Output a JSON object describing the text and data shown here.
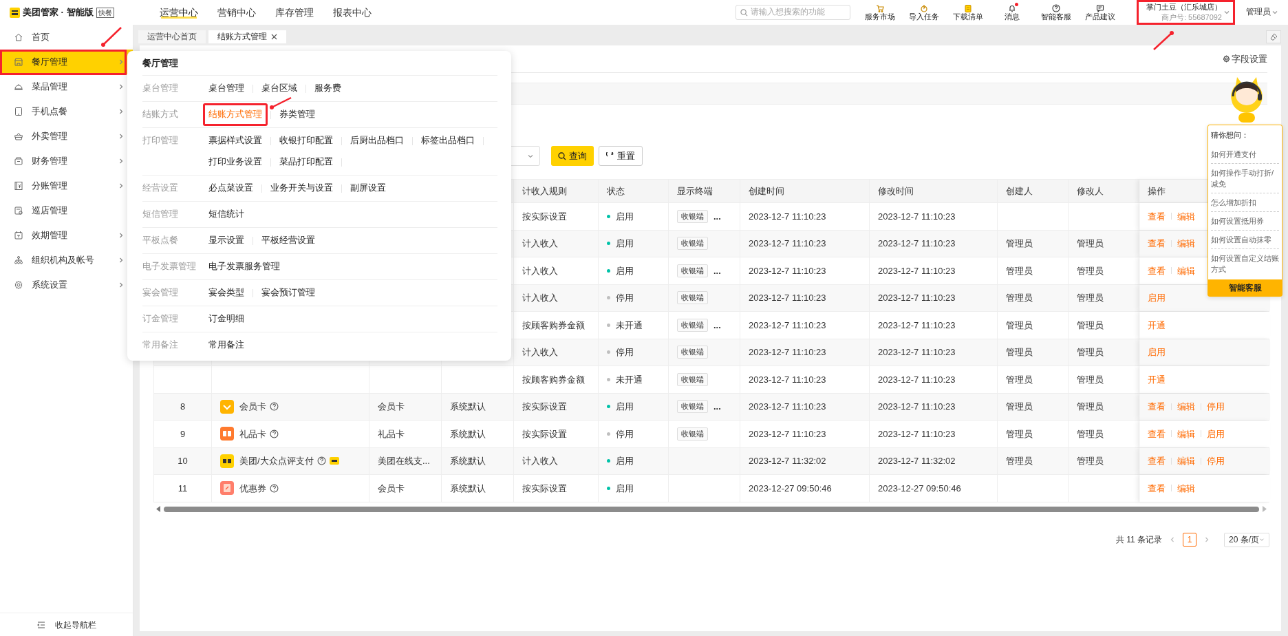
{
  "header": {
    "brand": "美团管家 · 智能版",
    "edition_badge": "快餐"
  },
  "top_nav": [
    {
      "label": "运营中心",
      "selected": true
    },
    {
      "label": "营销中心",
      "selected": false
    },
    {
      "label": "库存管理",
      "selected": false
    },
    {
      "label": "报表中心",
      "selected": false
    }
  ],
  "search": {
    "placeholder": "请输入想搜索的功能"
  },
  "toolbar": [
    {
      "label": "服务市场",
      "unread": false
    },
    {
      "label": "导入任务",
      "unread": false
    },
    {
      "label": "下载清单",
      "unread": false
    },
    {
      "label": "消息",
      "unread": true
    },
    {
      "label": "智能客服",
      "unread": false
    },
    {
      "label": "产品建议",
      "unread": false
    }
  ],
  "store": {
    "name": "掌门土豆（汇乐城店）",
    "merchant_id": "商户号: 55687092"
  },
  "user": "管理员",
  "sidebar": {
    "items": [
      {
        "label": "首页",
        "selected": false,
        "has_children": false
      },
      {
        "label": "餐厅管理",
        "selected": true,
        "has_children": true
      },
      {
        "label": "菜品管理",
        "selected": false,
        "has_children": true
      },
      {
        "label": "手机点餐",
        "selected": false,
        "has_children": true
      },
      {
        "label": "外卖管理",
        "selected": false,
        "has_children": true
      },
      {
        "label": "财务管理",
        "selected": false,
        "has_children": true
      },
      {
        "label": "分账管理",
        "selected": false,
        "has_children": true
      },
      {
        "label": "巡店管理",
        "selected": false,
        "has_children": false
      },
      {
        "label": "效期管理",
        "selected": false,
        "has_children": true
      },
      {
        "label": "组织机构及帐号",
        "selected": false,
        "has_children": true
      },
      {
        "label": "系统设置",
        "selected": false,
        "has_children": true
      }
    ],
    "collapse_label": "收起导航栏"
  },
  "tabs": [
    {
      "label": "运营中心首页",
      "selected": false,
      "closable": false
    },
    {
      "label": "结账方式管理",
      "selected": true,
      "closable": true
    }
  ],
  "field_settings": "字段设置",
  "filters": {
    "query_button": "查询",
    "reset_button": "重置"
  },
  "table": {
    "columns": [
      "计收入规则",
      "状态",
      "显示终端",
      "创建时间",
      "修改时间",
      "创建人",
      "修改人",
      "操作"
    ],
    "rows": [
      {
        "rule": "按实际设置",
        "status": "启用",
        "enabled": true,
        "terminal": "收银端",
        "more": "...",
        "created": "2023-12-7 11:10:23",
        "modified": "2023-12-7 11:10:23",
        "actions": [
          "查看",
          "编辑"
        ]
      },
      {
        "rule": "计入收入",
        "status": "启用",
        "enabled": true,
        "terminal": "收银端",
        "created": "2023-12-7 11:10:23",
        "modified": "2023-12-7 11:10:23",
        "creator": "管理员",
        "modifier": "管理员",
        "actions": [
          "查看",
          "编辑"
        ]
      },
      {
        "rule": "计入收入",
        "status": "启用",
        "enabled": true,
        "terminal": "收银端",
        "more": "...",
        "created": "2023-12-7 11:10:23",
        "modified": "2023-12-7 11:10:23",
        "creator": "管理员",
        "modifier": "管理员",
        "actions": [
          "查看",
          "编辑"
        ]
      },
      {
        "rule": "计入收入",
        "status": "停用",
        "enabled": false,
        "terminal": "收银端",
        "created": "2023-12-7 11:10:23",
        "modified": "2023-12-7 11:10:23",
        "creator": "管理员",
        "modifier": "管理员",
        "actions": [
          "启用"
        ]
      },
      {
        "rule": "按顾客购券金额",
        "status": "未开通",
        "enabled": false,
        "terminal": "收银端",
        "more": "...",
        "created": "2023-12-7 11:10:23",
        "modified": "2023-12-7 11:10:23",
        "creator": "管理员",
        "modifier": "管理员",
        "actions": [
          "开通"
        ]
      },
      {
        "rule": "计入收入",
        "status": "停用",
        "enabled": false,
        "terminal": "收银端",
        "created": "2023-12-7 11:10:23",
        "modified": "2023-12-7 11:10:23",
        "creator": "管理员",
        "modifier": "管理员",
        "actions": [
          "启用"
        ]
      },
      {
        "rule": "按顾客购券金额",
        "status": "未开通",
        "enabled": false,
        "terminal": "收银端",
        "created": "2023-12-7 11:10:23",
        "modified": "2023-12-7 11:10:23",
        "creator": "管理员",
        "modifier": "管理员",
        "actions": [
          "开通"
        ]
      },
      {
        "index": "8",
        "kind": "member",
        "name": "会员卡",
        "badge": false,
        "type": "会员卡",
        "source": "系统默认",
        "rule": "按实际设置",
        "status": "启用",
        "enabled": true,
        "terminal": "收银端",
        "more": "...",
        "created": "2023-12-7 11:10:23",
        "modified": "2023-12-7 11:10:23",
        "creator": "管理员",
        "modifier": "管理员",
        "actions": [
          "查看",
          "编辑",
          "停用"
        ]
      },
      {
        "index": "9",
        "kind": "gift",
        "name": "礼品卡",
        "badge": false,
        "type": "礼品卡",
        "source": "系统默认",
        "rule": "按实际设置",
        "status": "停用",
        "enabled": false,
        "terminal": "收银端",
        "created": "2023-12-7 11:10:23",
        "modified": "2023-12-7 11:10:23",
        "creator": "管理员",
        "modifier": "管理员",
        "actions": [
          "查看",
          "编辑",
          "启用"
        ]
      },
      {
        "index": "10",
        "kind": "meituan",
        "name": "美团/大众点评支付",
        "badge": true,
        "type": "美团在线支...",
        "source": "系统默认",
        "rule": "计入收入",
        "status": "启用",
        "enabled": true,
        "created": "2023-12-7 11:32:02",
        "modified": "2023-12-7 11:32:02",
        "creator": "管理员",
        "modifier": "管理员",
        "actions": [
          "查看",
          "编辑",
          "停用"
        ]
      },
      {
        "index": "11",
        "kind": "coupon",
        "name": "优惠券",
        "badge": false,
        "type": "会员卡",
        "source": "系统默认",
        "rule": "按实际设置",
        "status": "启用",
        "enabled": true,
        "created": "2023-12-27 09:50:46",
        "modified": "2023-12-27 09:50:46",
        "actions": [
          "查看",
          "编辑"
        ]
      }
    ]
  },
  "pagination": {
    "total": "共 11 条记录",
    "pages": [
      {
        "label": "1",
        "selected": true
      }
    ],
    "page_size": "20 条/页"
  },
  "mega_menu": {
    "title": "餐厅管理",
    "groups": [
      {
        "label": "桌台管理",
        "links": [
          {
            "label": "桌台管理",
            "selected": false
          },
          {
            "label": "桌台区域",
            "selected": false
          },
          {
            "label": "服务费",
            "selected": false
          }
        ]
      },
      {
        "label": "结账方式",
        "links": [
          {
            "label": "结账方式管理",
            "selected": true
          },
          {
            "label": "券类管理",
            "selected": false
          }
        ]
      },
      {
        "label": "打印管理",
        "links": [
          {
            "label": "票据样式设置",
            "selected": false
          },
          {
            "label": "收银打印配置",
            "selected": false
          },
          {
            "label": "后厨出品档口",
            "selected": false
          },
          {
            "label": "标签出品档口",
            "selected": false
          },
          {
            "label": "打印业务设置",
            "selected": false
          },
          {
            "label": "菜品打印配置",
            "selected": false
          }
        ]
      },
      {
        "label": "经营设置",
        "links": [
          {
            "label": "必点菜设置",
            "selected": false
          },
          {
            "label": "业务开关与设置",
            "selected": false
          },
          {
            "label": "副屏设置",
            "selected": false
          }
        ]
      },
      {
        "label": "短信管理",
        "links": [
          {
            "label": "短信统计",
            "selected": false
          }
        ]
      },
      {
        "label": "平板点餐",
        "links": [
          {
            "label": "显示设置",
            "selected": false
          },
          {
            "label": "平板经营设置",
            "selected": false
          }
        ]
      },
      {
        "label": "电子发票管理",
        "links": [
          {
            "label": "电子发票服务管理",
            "selected": false
          }
        ]
      },
      {
        "label": "宴会管理",
        "links": [
          {
            "label": "宴会类型",
            "selected": false
          },
          {
            "label": "宴会预订管理",
            "selected": false
          }
        ]
      },
      {
        "label": "订金管理",
        "links": [
          {
            "label": "订金明细",
            "selected": false
          }
        ]
      },
      {
        "label": "常用备注",
        "links": [
          {
            "label": "常用备注",
            "selected": false
          }
        ]
      }
    ]
  },
  "help_panel": {
    "title": "猜你想问：",
    "questions": [
      "如何开通支付",
      "如何操作手动打折/减免",
      "怎么增加折扣",
      "如何设置抵用券",
      "如何设置自动抹零",
      "如何设置自定义结账方式"
    ],
    "button": "智能客服"
  }
}
